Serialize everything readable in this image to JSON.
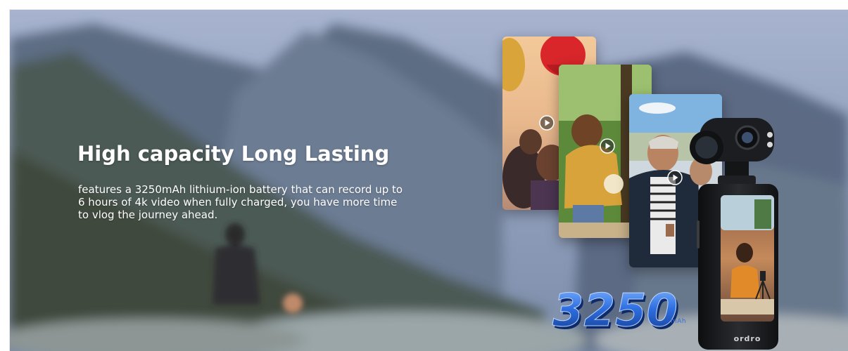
{
  "hero": {
    "title": "High capacity Long Lasting",
    "description": "features a 3250mAh lithium-ion battery that can record up to 6 hours of 4k video when fully charged, you have more time to vlog the journey ahead."
  },
  "battery": {
    "number": "3250",
    "unit": "mAh"
  },
  "camera": {
    "brand": "ordro"
  },
  "colors": {
    "title_text": "#ffffff",
    "battery_blue": "#2f6fe0",
    "camera_body": "#1c1d20"
  },
  "icons": [
    "play-icon",
    "camera-lens-icon",
    "hot-air-balloon-icon",
    "mini-tripod-icon"
  ]
}
